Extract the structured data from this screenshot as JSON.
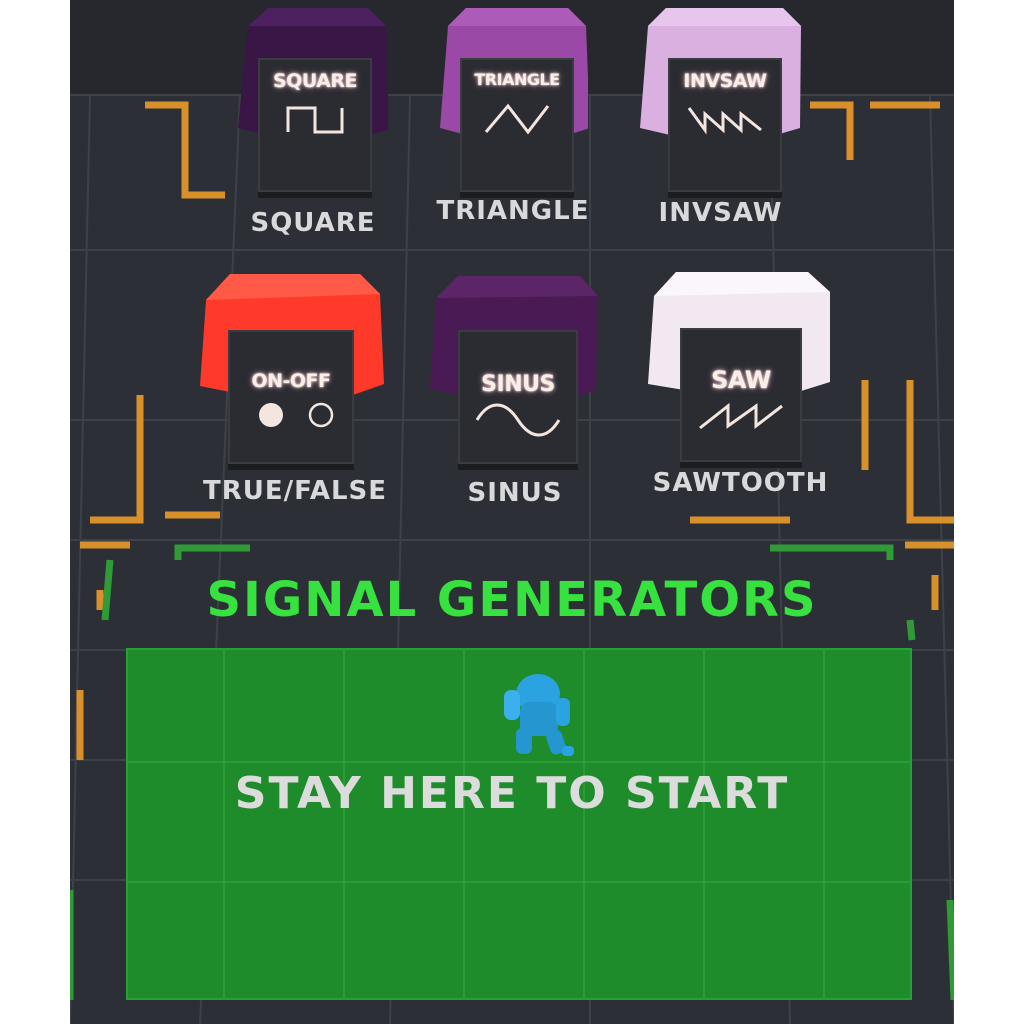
{
  "generators": [
    {
      "id": "square",
      "screen": "SQUARE",
      "caption": "SQUARE",
      "color": "#3a1646",
      "icon": "square-wave-icon"
    },
    {
      "id": "triangle",
      "screen": "TRIANGLE",
      "caption": "TRIANGLE",
      "color": "#9a49a6",
      "icon": "triangle-wave-icon"
    },
    {
      "id": "invsaw",
      "screen": "INVSAW",
      "caption": "INVSAW",
      "color": "#d9b0e0",
      "icon": "inverse-sawtooth-wave-icon"
    },
    {
      "id": "onoff",
      "screen": "ON-OFF",
      "caption": "TRUE/FALSE",
      "color": "#ff3a2a",
      "icon": "on-off-icon"
    },
    {
      "id": "sinus",
      "screen": "SINUS",
      "caption": "SINUS",
      "color": "#4a1a55",
      "icon": "sine-wave-icon"
    },
    {
      "id": "saw",
      "screen": "SAW",
      "caption": "SAWTOOTH",
      "color": "#f2e8f2",
      "icon": "sawtooth-wave-icon"
    }
  ],
  "title": "SIGNAL GENERATORS",
  "start_pad": {
    "text": "STAY HERE TO START",
    "color": "#1f8c2c"
  },
  "player": {
    "icon": "player-robot-icon",
    "color": "#2aa3e0"
  },
  "accent_colors": {
    "orange": "#d9902a",
    "green": "#37e13f",
    "floor": "#2c3036"
  }
}
